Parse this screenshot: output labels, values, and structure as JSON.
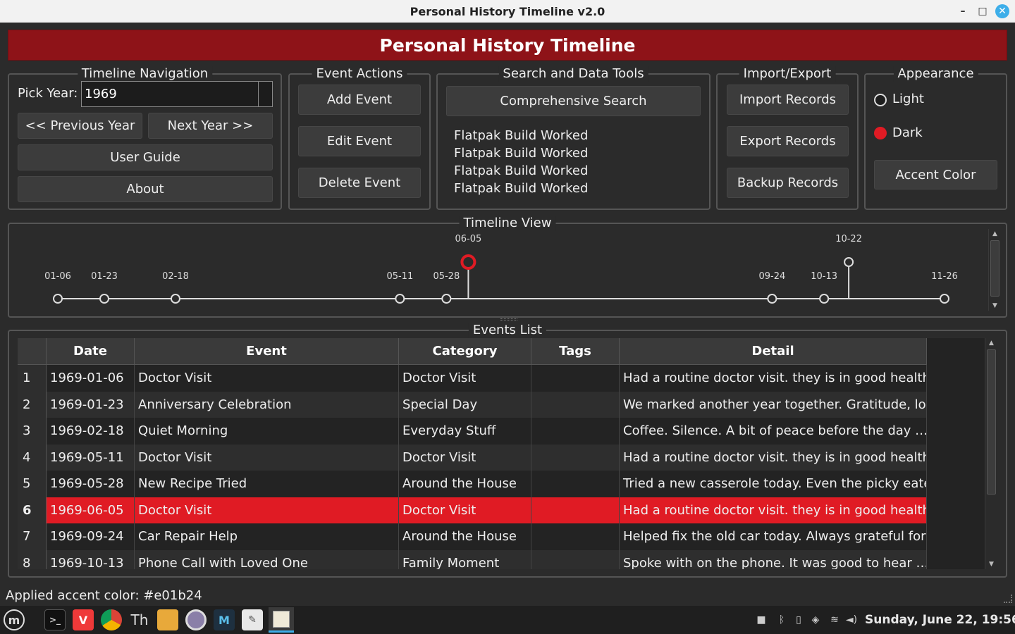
{
  "window": {
    "title": "Personal History Timeline v2.0",
    "minimize": "–",
    "maximize": "□",
    "close": "✕"
  },
  "banner": "Personal History Timeline",
  "nav": {
    "title": "Timeline Navigation",
    "pick_year_label": "Pick Year:",
    "year_value": "1969",
    "prev_label": "<< Previous Year",
    "next_label": "Next Year >>",
    "guide_label": "User Guide",
    "about_label": "About"
  },
  "event_actions": {
    "title": "Event Actions",
    "add": "Add Event",
    "edit": "Edit Event",
    "delete": "Delete Event"
  },
  "search": {
    "title": "Search and Data Tools",
    "button": "Comprehensive Search",
    "lines": [
      "Flatpak Build Worked",
      "Flatpak Build Worked",
      "Flatpak Build Worked",
      "Flatpak Build Worked"
    ]
  },
  "import_export": {
    "title": "Import/Export",
    "import": "Import Records",
    "export": "Export Records",
    "backup": "Backup Records"
  },
  "appearance": {
    "title": "Appearance",
    "light": "Light",
    "dark": "Dark",
    "accent": "Accent Color",
    "selected": "Dark"
  },
  "timeline": {
    "title": "Timeline View",
    "events": [
      {
        "date": "01-06",
        "raised": false,
        "selected": false
      },
      {
        "date": "01-23",
        "raised": false,
        "selected": false
      },
      {
        "date": "02-18",
        "raised": false,
        "selected": false
      },
      {
        "date": "05-11",
        "raised": false,
        "selected": false
      },
      {
        "date": "05-28",
        "raised": false,
        "selected": false
      },
      {
        "date": "06-05",
        "raised": true,
        "selected": true
      },
      {
        "date": "09-24",
        "raised": false,
        "selected": false
      },
      {
        "date": "10-13",
        "raised": false,
        "selected": false
      },
      {
        "date": "10-22",
        "raised": true,
        "selected": false
      },
      {
        "date": "11-26",
        "raised": false,
        "selected": false
      }
    ]
  },
  "events_list": {
    "title": "Events List",
    "columns": [
      "Date",
      "Event",
      "Category",
      "Tags",
      "Detail"
    ],
    "rows": [
      {
        "n": "1",
        "date": "1969-01-06",
        "event": "Doctor Visit",
        "category": "Doctor Visit",
        "tags": "",
        "detail": "Had a routine doctor visit. they is in good health…"
      },
      {
        "n": "2",
        "date": "1969-01-23",
        "event": "Anniversary Celebration",
        "category": "Special Day",
        "tags": "",
        "detail": "We marked another year together. Gratitude, lo…"
      },
      {
        "n": "3",
        "date": "1969-02-18",
        "event": "Quiet Morning",
        "category": "Everyday Stuff",
        "tags": "",
        "detail": "Coffee. Silence. A bit of peace before the day …"
      },
      {
        "n": "4",
        "date": "1969-05-11",
        "event": "Doctor Visit",
        "category": "Doctor Visit",
        "tags": "",
        "detail": "Had a routine doctor visit. they is in good health…"
      },
      {
        "n": "5",
        "date": "1969-05-28",
        "event": "New Recipe Tried",
        "category": "Around the House",
        "tags": "",
        "detail": "Tried a new casserole today. Even the picky eate…"
      },
      {
        "n": "6",
        "date": "1969-06-05",
        "event": "Doctor Visit",
        "category": "Doctor Visit",
        "tags": "",
        "detail": "Had a routine doctor visit. they is in good health…"
      },
      {
        "n": "7",
        "date": "1969-09-24",
        "event": "Car Repair Help",
        "category": "Around the House",
        "tags": "",
        "detail": "Helped fix the old car today. Always grateful for …"
      },
      {
        "n": "8",
        "date": "1969-10-13",
        "event": "Phone Call with Loved One",
        "category": "Family Moment",
        "tags": "",
        "detail": "Spoke with  on the phone. It was good to hear …"
      }
    ],
    "selected_row": 6
  },
  "status": "Applied accent color: #e01b24",
  "colors": {
    "accent": "#e01b24",
    "banner": "#8e1318",
    "background": "#2b2b2b"
  },
  "taskbar": {
    "icons": [
      "mint-menu-icon",
      "terminal-icon",
      "vivaldi-icon",
      "chrome-icon",
      "typography-icon",
      "files-icon",
      "camera-icon",
      "mail-icon",
      "text-editor-icon",
      "app-window-icon"
    ],
    "clock": "Sunday, June 22, 19:56"
  }
}
